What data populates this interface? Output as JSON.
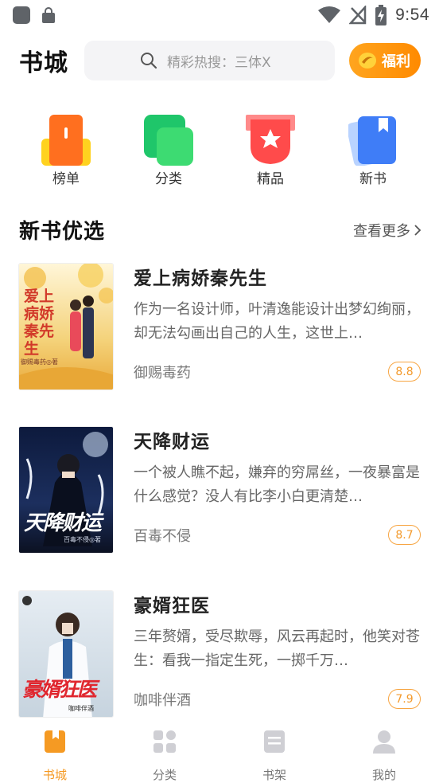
{
  "status_bar": {
    "time": "9:54"
  },
  "header": {
    "title": "书城",
    "search_placeholder": "精彩热搜：三体X",
    "welfare_label": "福利"
  },
  "categories": [
    {
      "label": "榜单",
      "icon": "ranking-icon"
    },
    {
      "label": "分类",
      "icon": "category-icon"
    },
    {
      "label": "精品",
      "icon": "premium-icon"
    },
    {
      "label": "新书",
      "icon": "new-book-icon"
    }
  ],
  "section": {
    "title": "新书优选",
    "more_label": "查看更多"
  },
  "books": [
    {
      "title": "爱上病娇秦先生",
      "description": "作为一名设计师，叶清逸能设计出梦幻绚丽，却无法勾画出自己的人生，这世上…",
      "author": "御赐毒药",
      "score": "8.8",
      "cover_text": "爱上病娇秦先生",
      "cover_author": "御赐毒药◎著"
    },
    {
      "title": "天降财运",
      "description": "一个被人瞧不起，嫌弃的穷屌丝，一夜暴富是什么感觉？没人有比李小白更清楚…",
      "author": "百毒不侵",
      "score": "8.7",
      "cover_text": "天降财运",
      "cover_author": "百毒不侵◎著"
    },
    {
      "title": "豪婿狂医",
      "description": "三年赘婿，受尽欺辱，风云再起时，他笑对苍生：看我一指定生死，一掷千万…",
      "author": "咖啡伴酒",
      "score": "7.9",
      "cover_text": "豪婿狂医",
      "cover_author": "咖啡伴酒"
    }
  ],
  "bottom_nav": [
    {
      "label": "书城",
      "active": true
    },
    {
      "label": "分类",
      "active": false
    },
    {
      "label": "书架",
      "active": false
    },
    {
      "label": "我的",
      "active": false
    }
  ],
  "colors": {
    "accent": "#f59a23",
    "score_border": "#f7a542"
  }
}
